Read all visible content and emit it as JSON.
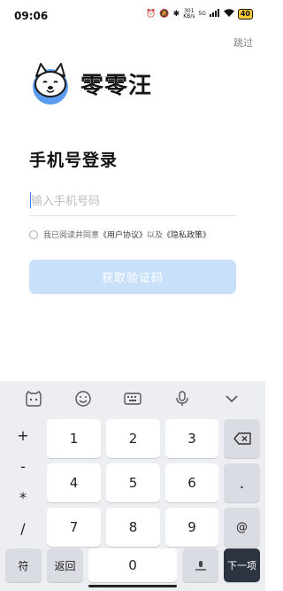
{
  "status": {
    "time": "09:06",
    "net_speed_top": "301",
    "net_speed_bottom": "KB/s",
    "network": "5G",
    "battery": "40"
  },
  "skip_label": "跳过",
  "logo": {
    "text": "零零汪"
  },
  "title": "手机号登录",
  "phone_input": {
    "placeholder": "输入手机号码",
    "value": ""
  },
  "agreement": {
    "prefix": "我已阅读并同意",
    "user_agreement": "《用户协议》",
    "middle": "以及",
    "privacy_policy": "《隐私政策》"
  },
  "get_code_button": "获取验证码",
  "keyboard": {
    "symbols": [
      "+",
      "-",
      "*",
      "/"
    ],
    "row1": [
      "1",
      "2",
      "3"
    ],
    "row2": [
      "4",
      "5",
      "6"
    ],
    "row3": [
      "7",
      "8",
      "9"
    ],
    "dot": ".",
    "at": "@",
    "symbol_key": "符",
    "back_key": "返回",
    "zero": "0",
    "next_key": "下一项"
  },
  "colors": {
    "accent_disabled": "#c8e0fa",
    "logo_blue": "#5b9bf0",
    "next_key_bg": "#2c3442"
  }
}
